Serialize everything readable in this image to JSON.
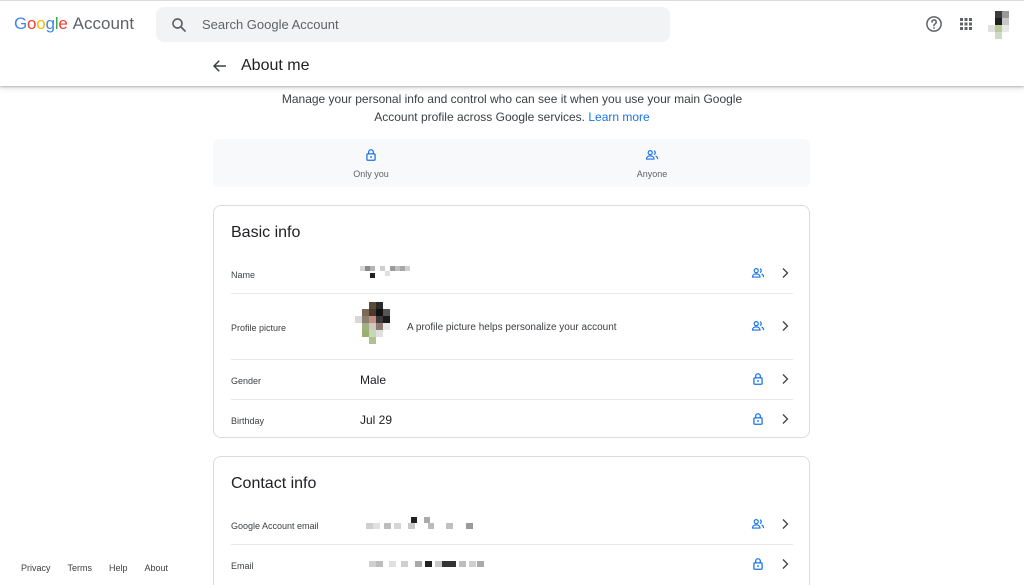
{
  "header": {
    "logo": {
      "g1": "G",
      "g2": "o",
      "g3": "o",
      "g4": "g",
      "g5": "l",
      "g6": "e",
      "account": "Account"
    },
    "search_placeholder": "Search Google Account"
  },
  "page": {
    "title": "About me",
    "intro_text": "Manage your personal info and control who can see it when you use your main Google Account profile across Google services.",
    "learn_more": "Learn more"
  },
  "visibility": {
    "only_you": "Only you",
    "anyone": "Anyone"
  },
  "basic_info": {
    "title": "Basic info",
    "rows": [
      {
        "label": "Name",
        "value": "",
        "visibility": "anyone"
      },
      {
        "label": "Profile picture",
        "value": "A profile picture helps personalize your account",
        "visibility": "anyone"
      },
      {
        "label": "Gender",
        "value": "Male",
        "visibility": "only-you"
      },
      {
        "label": "Birthday",
        "value": "Jul 29",
        "visibility": "only-you"
      }
    ]
  },
  "contact_info": {
    "title": "Contact info",
    "rows": [
      {
        "label": "Google Account email",
        "value": "",
        "visibility": "anyone"
      },
      {
        "label": "Email",
        "value": "",
        "visibility": "only-you"
      }
    ]
  },
  "footer": {
    "links": [
      "Privacy",
      "Terms",
      "Help",
      "About"
    ]
  },
  "colors": {
    "accent": "#1a73e8",
    "text": "#202124",
    "muted": "#5f6368",
    "border": "#dadce0"
  }
}
